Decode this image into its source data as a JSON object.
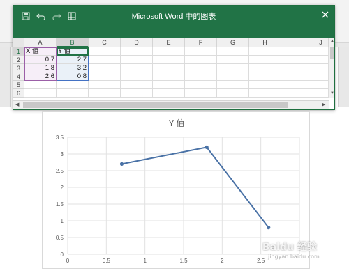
{
  "window": {
    "title": "Microsoft Word 中的图表",
    "save_icon": "save-icon",
    "undo_icon": "undo-icon",
    "redo_icon": "redo-icon",
    "edit_data_icon": "table-icon",
    "close_icon": "close-icon",
    "title_color": "#217346"
  },
  "sheet": {
    "columns": [
      "A",
      "B",
      "C",
      "D",
      "E",
      "F",
      "G",
      "H",
      "I",
      "J"
    ],
    "rows": [
      "1",
      "2",
      "3",
      "4",
      "5",
      "6"
    ],
    "selected_column": "B",
    "selected_row": "1",
    "cells": {
      "A1": "X 值",
      "B1": "Y 值",
      "A2": "0.7",
      "B2": "2.7",
      "A3": "1.8",
      "B3": "3.2",
      "A4": "2.6",
      "B4": "0.8"
    }
  },
  "chart_data": {
    "type": "scatter",
    "title": "Y 值",
    "x": [
      0.7,
      1.8,
      2.6
    ],
    "y": [
      2.7,
      3.2,
      0.8
    ],
    "xlim": [
      0,
      3
    ],
    "ylim": [
      0,
      3.5
    ],
    "x_ticks": [
      "0",
      "0.5",
      "1",
      "1.5",
      "2",
      "2.5"
    ],
    "y_ticks": [
      "0",
      "0.5",
      "1",
      "1.5",
      "2",
      "2.5",
      "3",
      "3.5"
    ],
    "series_color": "#4a72a6",
    "grid": true
  },
  "watermark": {
    "text": "Baidu 经验",
    "sub": "jingyan.baidu.com"
  }
}
